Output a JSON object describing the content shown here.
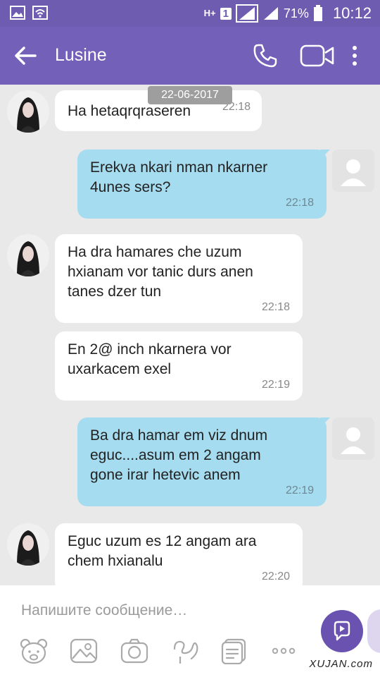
{
  "status_bar": {
    "network": "H+",
    "sim_slot": "1",
    "battery": "71%",
    "time": "10:12"
  },
  "header": {
    "title": "Lusine",
    "back_icon": "arrow-left-icon",
    "call_icon": "phone-icon",
    "video_icon": "video-camera-icon",
    "more_icon": "more-vertical-icon"
  },
  "date_separator": "22-06-2017",
  "messages": [
    {
      "direction": "incoming",
      "text": "Ha hetaqrqraseren",
      "time": "22:18"
    },
    {
      "direction": "outgoing",
      "text": "Erekva nkari nman nkarner\n4unes sers?",
      "time": "22:18"
    },
    {
      "direction": "incoming",
      "text": "Ha dra hamares che uzum\nhxianam vor tanic durs anen\ntanes dzer tun",
      "time": "22:18"
    },
    {
      "direction": "incoming",
      "text": "En 2@ inch nkarnera vor\nuxarkacem exel",
      "time": "22:19"
    },
    {
      "direction": "outgoing",
      "text": "Ba dra hamar em viz dnum\neguc....asum em 2 angam\ngone irar hetevic anem",
      "time": "22:19"
    },
    {
      "direction": "incoming",
      "text": "Eguc uzum es 12 angam ara\nchem hxianalu",
      "time": "22:20"
    }
  ],
  "composer": {
    "placeholder": "Напишите сообщение…",
    "send_icon": "send-chat-icon",
    "tools": [
      "sticker-bear-icon",
      "gallery-icon",
      "camera-icon",
      "doodle-icon",
      "gif-icon",
      "more-horizontal-icon"
    ]
  },
  "colors": {
    "header": "#7360b9",
    "status_bar": "#6d5cb0",
    "chat_bg": "#e9e9ea",
    "incoming_bubble": "#ffffff",
    "outgoing_bubble": "#a6dcef",
    "send_button": "#6a53b0"
  },
  "watermark": "XUJAN.com"
}
